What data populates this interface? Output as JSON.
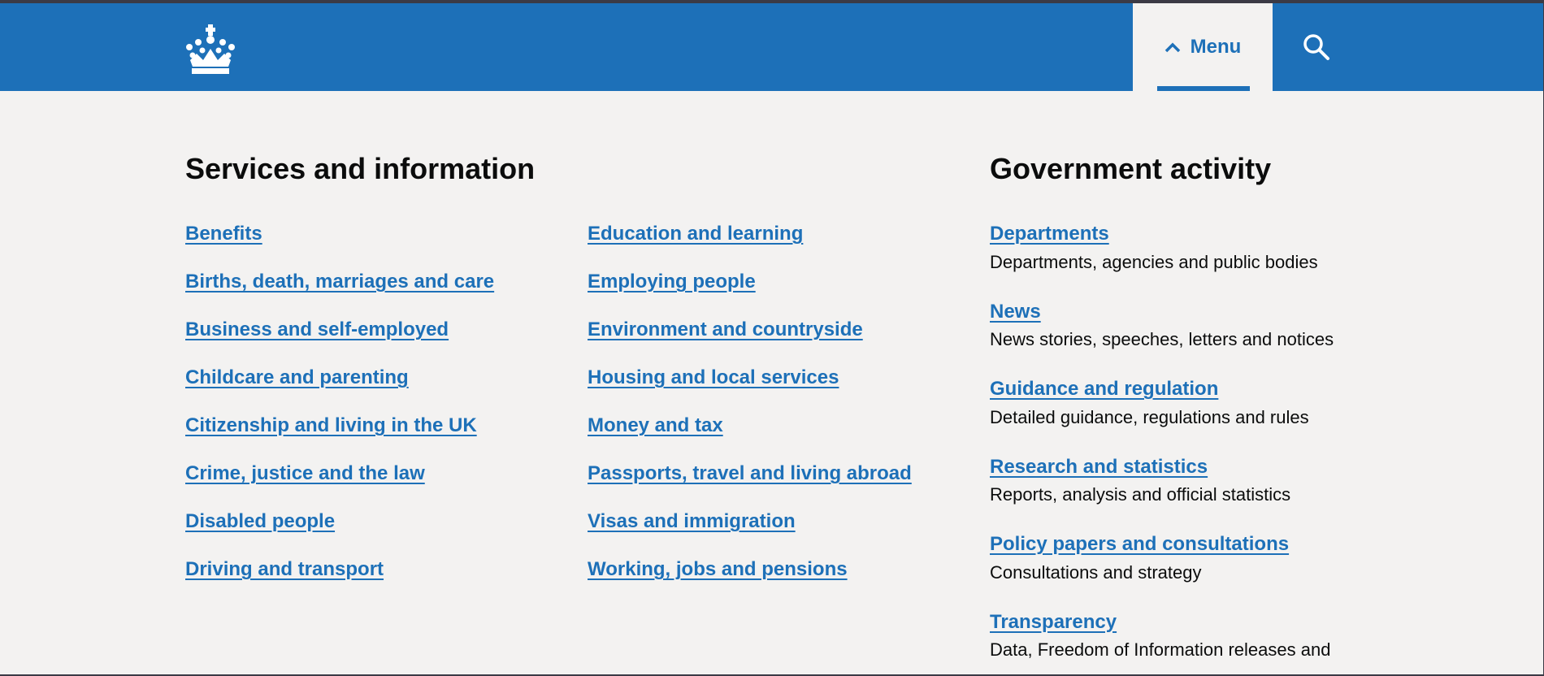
{
  "header": {
    "logo_icon": "crown-icon",
    "menu_label": "Menu",
    "menu_icon": "chevron-up-icon",
    "search_icon": "search-icon",
    "brand_color": "#1d70b8"
  },
  "services": {
    "title": "Services and information",
    "column_1": [
      "Benefits",
      "Births, death, marriages and care",
      "Business and self-employed",
      "Childcare and parenting",
      "Citizenship and living in the UK",
      "Crime, justice and the law",
      "Disabled people",
      "Driving and transport"
    ],
    "column_2": [
      "Education and learning",
      "Employing people",
      "Environment and countryside",
      "Housing and local services",
      "Money and tax",
      "Passports, travel and living abroad",
      "Visas and immigration",
      "Working, jobs and pensions"
    ]
  },
  "government_activity": {
    "title": "Government activity",
    "items": [
      {
        "label": "Departments",
        "description": "Departments, agencies and public bodies"
      },
      {
        "label": "News",
        "description": "News stories, speeches, letters and notices"
      },
      {
        "label": "Guidance and regulation",
        "description": "Detailed guidance, regulations and rules"
      },
      {
        "label": "Research and statistics",
        "description": "Reports, analysis and official statistics"
      },
      {
        "label": "Policy papers and consultations",
        "description": "Consultations and strategy"
      },
      {
        "label": "Transparency",
        "description": "Data, Freedom of Information releases and"
      }
    ]
  },
  "colors": {
    "link": "#1d70b8",
    "text": "#0b0c0c",
    "background": "#f3f2f1"
  }
}
